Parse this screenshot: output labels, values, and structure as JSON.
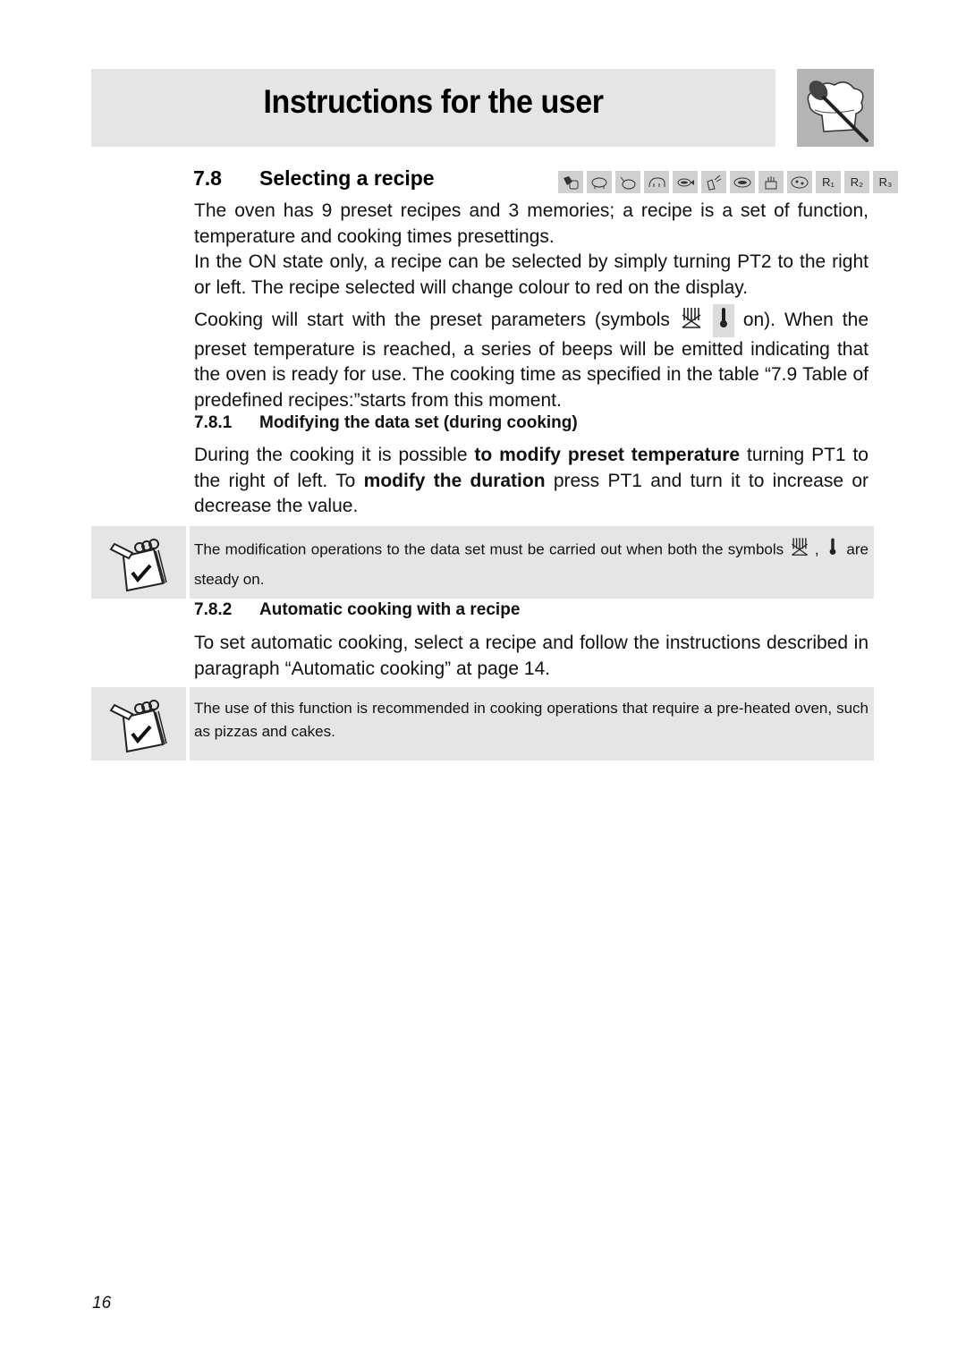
{
  "header": {
    "title": "Instructions for the user",
    "logo_icon": "chef-hat-spoon-icon"
  },
  "section": {
    "number": "7.8",
    "title": "Selecting a recipe",
    "recipe_icons": [
      {
        "name": "recipe-1-icon",
        "label": ""
      },
      {
        "name": "recipe-2-pork-icon",
        "label": ""
      },
      {
        "name": "recipe-3-chicken-icon",
        "label": ""
      },
      {
        "name": "recipe-4-lamb-icon",
        "label": ""
      },
      {
        "name": "recipe-5-fish-icon",
        "label": ""
      },
      {
        "name": "recipe-6-vegetables-icon",
        "label": ""
      },
      {
        "name": "recipe-7-lasagne-icon",
        "label": ""
      },
      {
        "name": "recipe-8-cake-icon",
        "label": ""
      },
      {
        "name": "recipe-9-pizza-icon",
        "label": ""
      },
      {
        "name": "memory-r1",
        "label": "R₁"
      },
      {
        "name": "memory-r2",
        "label": "R₂"
      },
      {
        "name": "memory-r3",
        "label": "R₃"
      }
    ],
    "para1": "The oven has 9 preset recipes and 3 memories; a recipe is a set of function, temperature and cooking times presettings.",
    "para2": "In the ON state only, a recipe can be selected by simply turning PT2 to the right or left. The recipe selected will change colour to red on the display.",
    "para3_before": "Cooking will start with the preset parameters (symbols",
    "para3_after": "on). When the preset temperature is reached, a series of beeps will be emitted indicating that the oven is ready for use. The cooking time as specified in the table “7.9 Table of predefined recipes:”starts from this moment."
  },
  "sub1": {
    "number": "7.8.1",
    "title": "Modifying the data set (during cooking)",
    "text_a": "During the cooking it is possible ",
    "bold_a": "to modify preset temperature",
    "text_b": " turning PT1 to the right of left. To  ",
    "bold_b": "modify the duration",
    "text_c": " press PT1 and turn it to increase or decrease the value."
  },
  "note1": {
    "text_before": "The modification operations to the data set must be carried out when both the symbols",
    "comma": ",",
    "text_after": "are steady on."
  },
  "sub2": {
    "number": "7.8.2",
    "title": "Automatic cooking with a recipe",
    "text": "To set automatic cooking, select a recipe and follow the instructions described in paragraph “Automatic cooking” at page 14."
  },
  "note2": {
    "text": "The use of this function is recommended in cooking operations that require a pre-heated oven, such as pizzas and cakes."
  },
  "footer": {
    "page_number": "16"
  }
}
